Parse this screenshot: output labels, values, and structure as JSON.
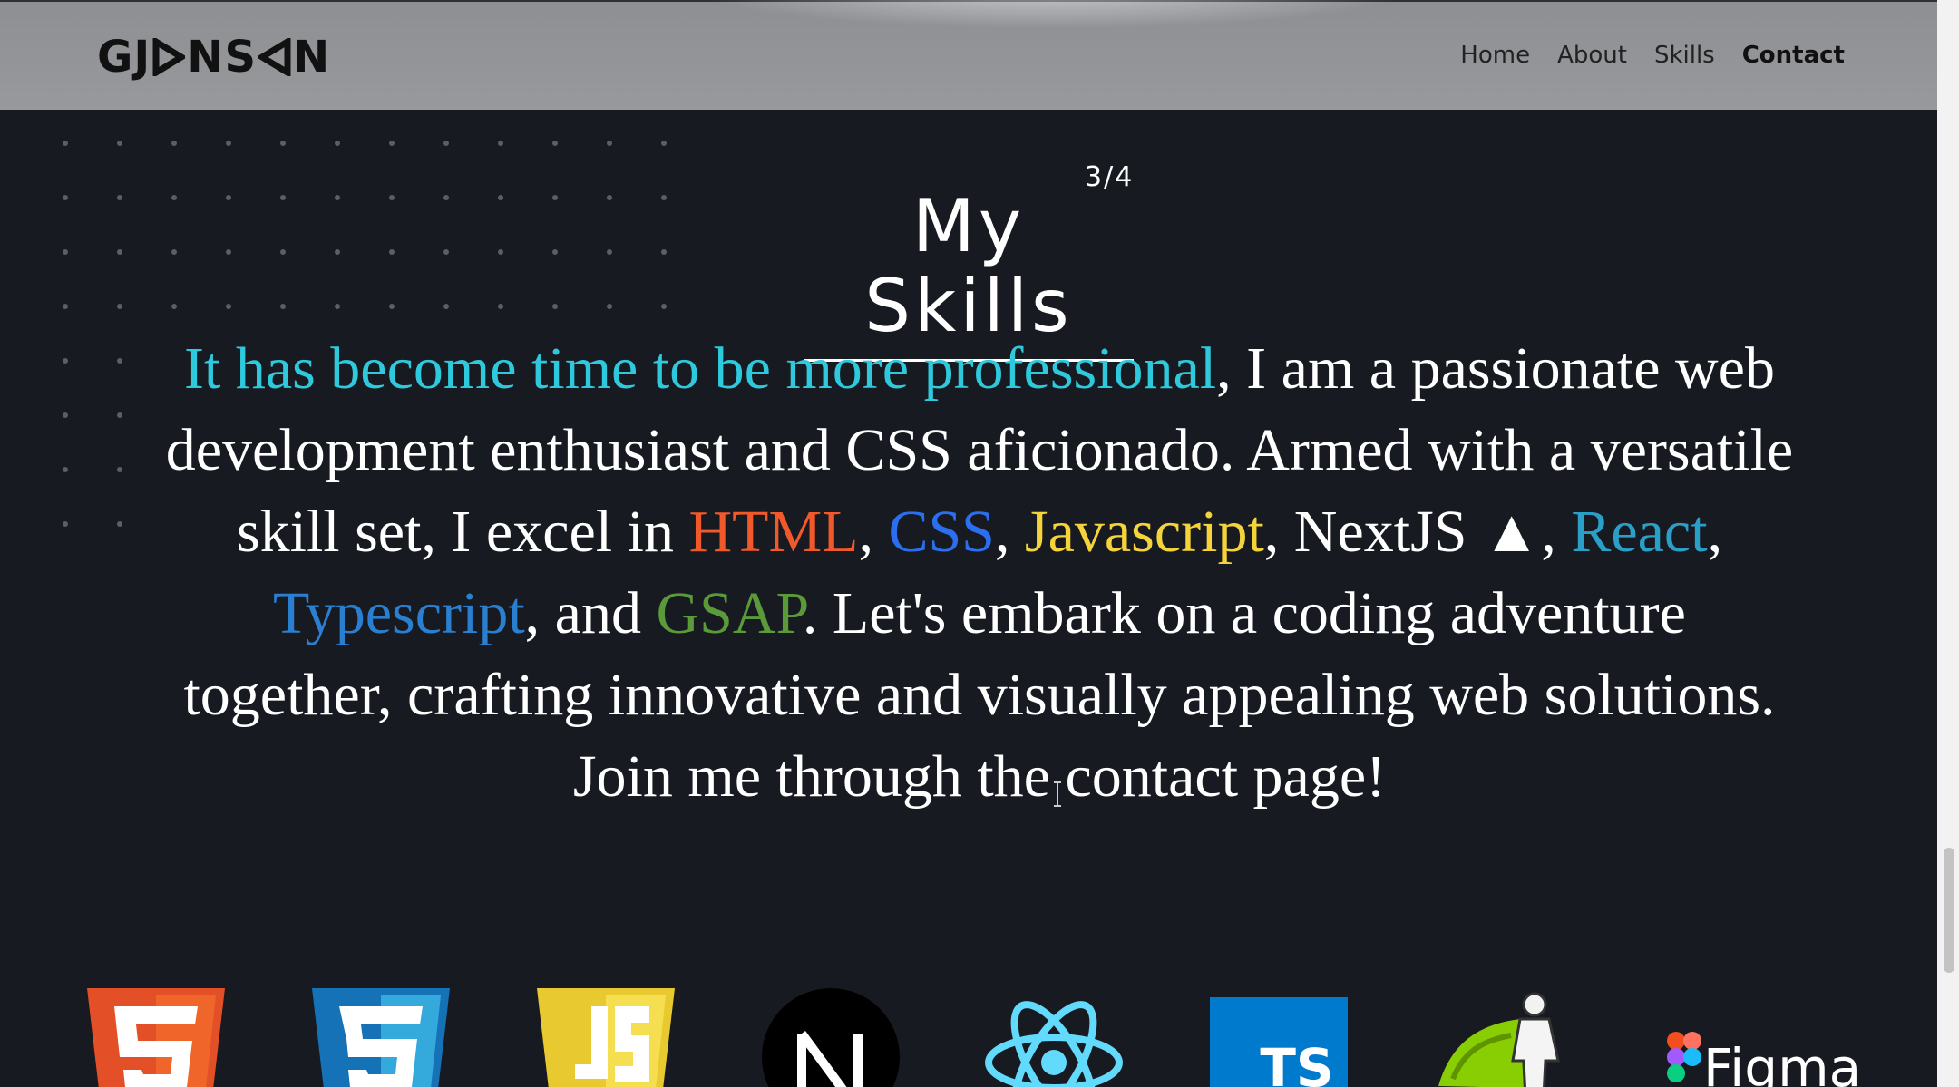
{
  "header": {
    "logo": {
      "text_left": "GJ",
      "text_mid": "NS",
      "text_right": "N"
    },
    "nav": [
      {
        "label": "Home",
        "active": false
      },
      {
        "label": "About",
        "active": false
      },
      {
        "label": "Skills",
        "active": false
      },
      {
        "label": "Contact",
        "active": true
      }
    ]
  },
  "section": {
    "counter": "3/4",
    "title": "My Skills"
  },
  "bio": {
    "intro": "It has become time to be more professional",
    "part1": ", I am a passionate web development enthusiast and CSS aficionado. Armed with a versatile skill set, I excel in ",
    "html": "HTML",
    "sep1": ", ",
    "css": "CSS",
    "sep2": ", ",
    "js": "Javascript",
    "sep3": ", NextJS ▲,",
    "react": "React",
    "sep4": ", ",
    "ts": "Typescript",
    "sep5": ", and ",
    "gsap": "GSAP",
    "part2": ". Let's embark on a coding adventure together, crafting innovative and visually appealing web solutions. Join me through the contact page!"
  },
  "tech_icons": [
    {
      "name": "html5",
      "color": "#e34f26"
    },
    {
      "name": "css3",
      "color": "#1572b6"
    },
    {
      "name": "javascript",
      "color": "#f0db4f"
    },
    {
      "name": "nextjs",
      "color": "#000000"
    },
    {
      "name": "react",
      "color": "#61dafb"
    },
    {
      "name": "typescript",
      "color": "#007acc",
      "text": "TS"
    },
    {
      "name": "gsap",
      "color": "#88ce02"
    },
    {
      "name": "figma",
      "text": "Figma"
    }
  ],
  "colors": {
    "background": "#171a20",
    "header": "#95969a",
    "accent_cyan": "#2ec9dc"
  }
}
